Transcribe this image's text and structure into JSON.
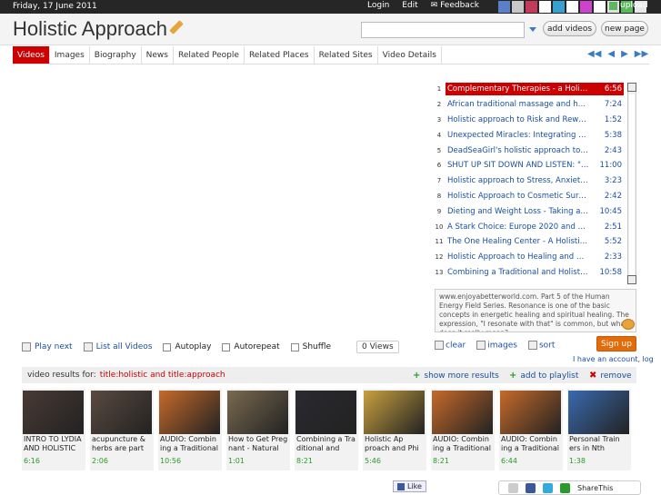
{
  "topbar": {
    "date": "Friday, 17 June 2011",
    "login": "Login",
    "edit": "Edit",
    "feedback": "Feedback",
    "upload": "upload",
    "swatches": [
      "#5b7fc8",
      "#c8c8c8",
      "#c43a5a",
      "#ffffff",
      "#3aa0d0",
      "#ffffff",
      "#cc44cc",
      "#ffffff",
      "#e0e0e0",
      "#5cb85c",
      "#e8e8e8"
    ]
  },
  "header": {
    "title": "Holistic Approach",
    "search_placeholder": "",
    "add_videos": "add videos",
    "new_page": "new page"
  },
  "tabs": [
    "Videos",
    "Images",
    "Biography",
    "News",
    "Related People",
    "Related Places",
    "Related Sites",
    "Video Details"
  ],
  "pager": [
    "◀◀",
    "◀",
    "▶",
    "▶▶"
  ],
  "playlist": [
    {
      "n": "1",
      "title": "Complementary Therapies - a Holistic Ap...",
      "dur": "6:56",
      "active": true
    },
    {
      "n": "2",
      "title": "African traditional massage and holistic ...",
      "dur": "7:24"
    },
    {
      "n": "3",
      "title": "Holistic approach to Risk and Reward M...",
      "dur": "1:52"
    },
    {
      "n": "4",
      "title": "Unexpected Miracles: Integrating a holis...",
      "dur": "5:38"
    },
    {
      "n": "5",
      "title": "DeadSeaGirl's holistic approach to acne...",
      "dur": "2:43"
    },
    {
      "n": "6",
      "title": "SHUT UP SIT DOWN AND LISTEN: \"hol...",
      "dur": "11:00"
    },
    {
      "n": "7",
      "title": "Holistic approach to Stress, Anxiety and...",
      "dur": "3:23"
    },
    {
      "n": "8",
      "title": "Holistic Approach to Cosmetic Surgery ...",
      "dur": "2:42"
    },
    {
      "n": "9",
      "title": "Dieting and Weight Loss - Taking a Hea...",
      "dur": "10:45"
    },
    {
      "n": "10",
      "title": "A Stark Choice: Europe 2020 and a Hol...",
      "dur": "2:51"
    },
    {
      "n": "11",
      "title": "The One Healing Center - A Holistic App...",
      "dur": "5:52"
    },
    {
      "n": "12",
      "title": "Holistic Approach to Healing and Dealir...",
      "dur": "2:33"
    },
    {
      "n": "13",
      "title": "Combining a Traditional and Holistic Ap...",
      "dur": "10:58"
    }
  ],
  "description": "www.enjoyabetterworld.com. Part 5 of the Human Energy Field Series. Resonance is one of the basic concepts in energetic healing and spiritual healing. The expression, \"I resonate with that\" is common, but what does it really mean?",
  "controls": {
    "play_next": "Play next",
    "list_all": "List all Videos",
    "autoplay": "Autoplay",
    "autorepeat": "Autorepeat",
    "shuffle": "Shuffle",
    "views": "0 Views",
    "clear": "clear",
    "images": "images",
    "sort": "sort",
    "signup": "Sign up",
    "account": "I have an account, log"
  },
  "results": {
    "label": "video results for:",
    "query": "title:holistic and title:approach",
    "show_more": "show more results",
    "add_playlist": "add to playlist",
    "remove": "remove"
  },
  "thumbs": [
    {
      "title": "INTRO TO LYDIA AND HOLISTIC",
      "dur": "6:16",
      "color": "#4a3a34"
    },
    {
      "title": "acupuncture & herbs are part of",
      "dur": "2:06",
      "color": "#5a4a40"
    },
    {
      "title": "AUDIO: Combin ing a Traditional",
      "dur": "10:56",
      "color": "#c66a2a"
    },
    {
      "title": "How to Get Preg nant - Natural",
      "dur": "1:01",
      "color": "#7a6a50"
    },
    {
      "title": "Combining a Tra ditional and Holis",
      "dur": "8:21",
      "color": "#2a2a30"
    },
    {
      "title": "Holistic Ap proach and Phi",
      "dur": "5:46",
      "color": "#c8a040"
    },
    {
      "title": "AUDIO: Combin ing a Traditional",
      "dur": "8:21",
      "color": "#c66a2a"
    },
    {
      "title": "AUDIO: Combin ing a Traditional",
      "dur": "6:44",
      "color": "#c66a2a"
    },
    {
      "title": "Personal Train ers in Nth Fitzroy-",
      "dur": "1:38",
      "color": "#3a6ab0"
    }
  ],
  "footer": {
    "like": "Like",
    "share": "ShareThis"
  }
}
